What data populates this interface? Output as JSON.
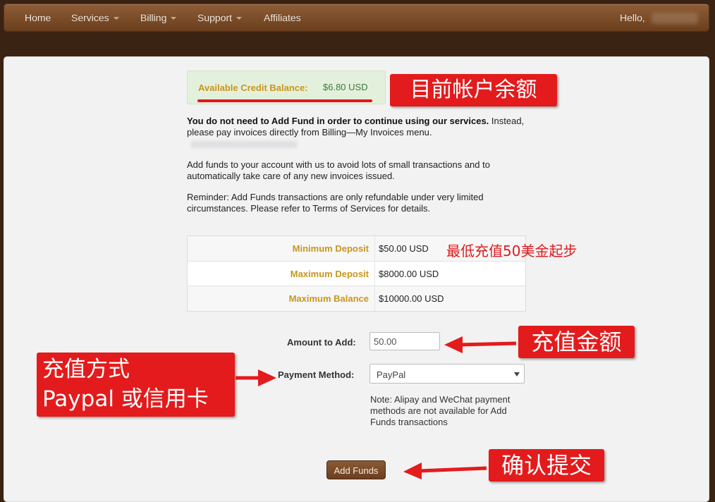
{
  "nav": {
    "items": [
      {
        "label": "Home",
        "dropdown": false
      },
      {
        "label": "Services",
        "dropdown": true
      },
      {
        "label": "Billing",
        "dropdown": true
      },
      {
        "label": "Support",
        "dropdown": true
      },
      {
        "label": "Affiliates",
        "dropdown": false
      }
    ],
    "greeting": "Hello,"
  },
  "credit": {
    "label": "Available Credit Balance:",
    "value": "$6.80 USD"
  },
  "intro": {
    "bold_text": "You do not need to Add Fund in order to continue using our services.",
    "rest_text": " Instead, please pay invoices directly from Billing—My Invoices menu.",
    "para2": "Add funds to your account with us to avoid lots of small transactions and to automatically take care of any new invoices issued.",
    "para3": "Reminder: Add Funds transactions are only refundable under very limited circumstances. Please refer to Terms of Services for details."
  },
  "deposits": [
    {
      "label": "Minimum Deposit",
      "value": "$50.00 USD"
    },
    {
      "label": "Maximum Deposit",
      "value": "$8000.00 USD"
    },
    {
      "label": "Maximum Balance",
      "value": "$10000.00 USD"
    }
  ],
  "form": {
    "amount_label": "Amount to Add:",
    "amount_value": "50.00",
    "payment_label": "Payment Method:",
    "payment_value": "PayPal",
    "note": "Note: Alipay and WeChat payment methods are not available for Add Funds transactions",
    "submit_label": "Add Funds"
  },
  "annotations": {
    "balance": "目前帐户余额",
    "min_deposit": "最低充值50美金起步",
    "amount": "充值金额",
    "method_line1": "充值方式",
    "method_line2": "Paypal 或信用卡",
    "submit": "确认提交"
  },
  "colors": {
    "nav_bg": "#7b4c29",
    "label_gold": "#c8961e",
    "annotation_red": "#e31b1c",
    "credit_green_bg": "#e3f1dc"
  }
}
